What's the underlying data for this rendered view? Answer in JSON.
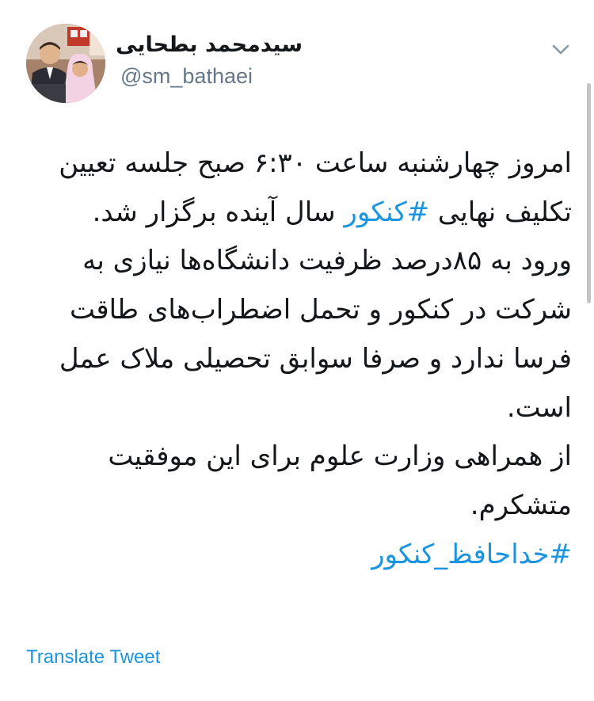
{
  "author": {
    "display_name": "سیدمحمد بطحایی",
    "handle": "@sm_bathaei",
    "avatar_icon": "profile-photo"
  },
  "tweet": {
    "paragraphs": [
      [
        {
          "text": "امروز چهارشنبه ساعت ۶:۳۰ صبح جلسه تعیین تکلیف نهایی ",
          "hashtag": false
        },
        {
          "text": "#کنکور",
          "hashtag": true
        },
        {
          "text": " سال آینده برگزار شد.",
          "hashtag": false
        }
      ],
      [
        {
          "text": "ورود به ۸۵درصد ظرفیت دانشگاه‌ها نیازی به شرکت در کنکور و تحمل اضطراب‌های طاقت فرسا ندارد و صرفا سوابق تحصیلی ملاک عمل است.",
          "hashtag": false
        }
      ],
      [
        {
          "text": "از همراهی وزارت علوم برای این موفقیت متشکرم.",
          "hashtag": false
        }
      ],
      [
        {
          "text": "#خداحافظ_کنکور",
          "hashtag": true
        }
      ]
    ]
  },
  "actions": {
    "translate_label": "Translate Tweet",
    "menu_icon": "chevron-down-icon"
  },
  "colors": {
    "link": "#1b95e0",
    "text": "#14171a",
    "secondary": "#657786"
  }
}
